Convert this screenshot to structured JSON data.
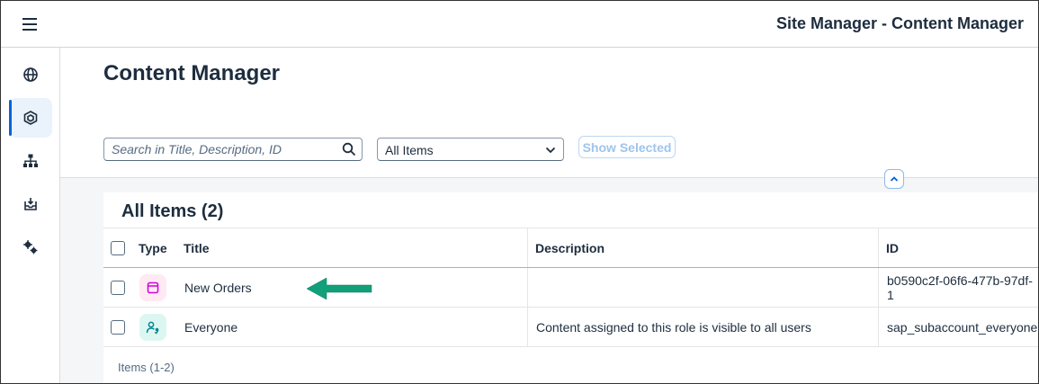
{
  "shell": {
    "app_title": "Site Manager - Content Manager"
  },
  "sidenav": {
    "items": [
      {
        "name": "globe-icon",
        "active": false
      },
      {
        "name": "content-manager-icon",
        "active": true
      },
      {
        "name": "hierarchy-icon",
        "active": false
      },
      {
        "name": "inbox-download-icon",
        "active": false
      },
      {
        "name": "settings-gears-icon",
        "active": false
      }
    ]
  },
  "page": {
    "title": "Content Manager"
  },
  "filters": {
    "search_placeholder": "Search in Title, Description, ID",
    "select_value": "All Items",
    "show_selected_label": "Show Selected"
  },
  "table": {
    "title": "All Items (2)",
    "columns": {
      "type": "Type",
      "title": "Title",
      "description": "Description",
      "id": "ID"
    },
    "rows": [
      {
        "type_icon": "app-window-icon",
        "type_color": "#ffeaf4",
        "icon_color": "#cc00dc",
        "title": "New Orders",
        "description": "",
        "id": "b0590c2f-06f6-477b-97df-1"
      },
      {
        "type_icon": "role-person-icon",
        "type_color": "#dcf7f1",
        "icon_color": "#07838f",
        "title": "Everyone",
        "description": "Content assigned to this role is visible to all users",
        "id": "sap_subaccount_everyone"
      }
    ],
    "footer": "Items (1-2)"
  },
  "colors": {
    "accent": "#0064d9",
    "annotation_arrow": "#12a07a"
  }
}
